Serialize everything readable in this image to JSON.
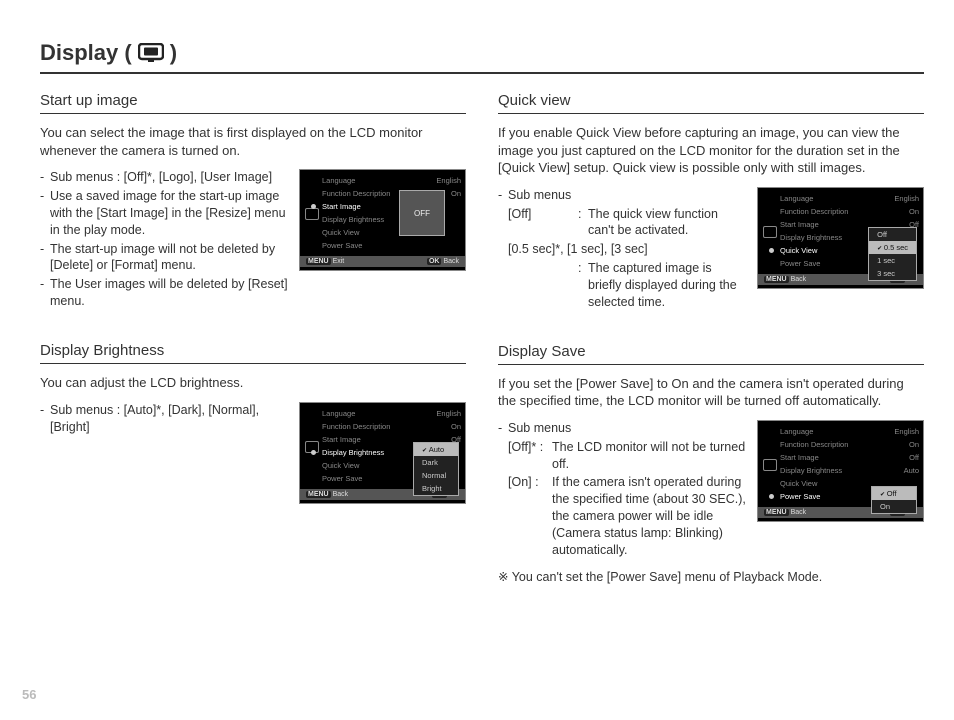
{
  "page_number": "56",
  "title_prefix": "Display (",
  "title_suffix": ")",
  "left": {
    "s1": {
      "head": "Start up image",
      "intro": "You can select the image that is first displayed on the LCD monitor whenever the camera is turned on.",
      "b1": "Sub menus : [Off]*, [Logo], [User Image]",
      "b2": "Use a saved image for the start-up image with the [Start Image] in the [Resize] menu in the play mode.",
      "b3": "The start-up image will not be deleted by [Delete] or [Format] menu.",
      "b4": "The User images will be deleted by [Reset] menu."
    },
    "s2": {
      "head": "Display Brightness",
      "intro": "You can adjust the LCD brightness.",
      "b1": "Sub menus : [Auto]*, [Dark], [Normal], [Bright]"
    }
  },
  "right": {
    "s1": {
      "head": "Quick view",
      "intro": "If you enable Quick View before capturing an image, you can view the image you just captured on the LCD monitor for the duration set in the [Quick View] setup. Quick view is possible only with still images.",
      "b1": "Sub menus",
      "o1l": "[Off]",
      "o1d": "The quick view function can't be activated.",
      "o2l": "[0.5 sec]*, [1 sec], [3 sec]",
      "o2d": "The captured image is briefly displayed during the selected time."
    },
    "s2": {
      "head": "Display Save",
      "intro": "If you set the [Power Save] to On and the camera isn't operated during the specified time, the LCD monitor will be turned off automatically.",
      "b1": "Sub menus",
      "o1l": "[Off]* :",
      "o1d": "The LCD monitor will not be turned off.",
      "o2l": "[On] :",
      "o2d": "If the camera isn't operated during the specified time (about 30 SEC.), the camera power will be idle (Camera status lamp: Blinking) automatically.",
      "note": "You can't set the [Power Save] menu of Playback Mode."
    }
  },
  "menu": {
    "m1": "Language",
    "v1": "English",
    "m2": "Function Description",
    "v2": "On",
    "m3": "Start Image",
    "v3": "Off",
    "m4": "Display  Brightness",
    "v4": "Auto",
    "m5": "Quick View",
    "v5": "0.5 sec",
    "m6": "Power Save",
    "v6": "Off",
    "f_exit": "Exit",
    "f_back": "Back",
    "f_set": "Set",
    "k_menu": "MENU",
    "k_ok": "OK",
    "big_off": "OFF",
    "br_auto": "Auto",
    "br_dark": "Dark",
    "br_normal": "Normal",
    "br_bright": "Bright",
    "qv_off": "Off",
    "qv_05": "0.5 sec",
    "qv_1": "1 sec",
    "qv_3": "3 sec",
    "ps_off": "Off",
    "ps_on": "On"
  }
}
